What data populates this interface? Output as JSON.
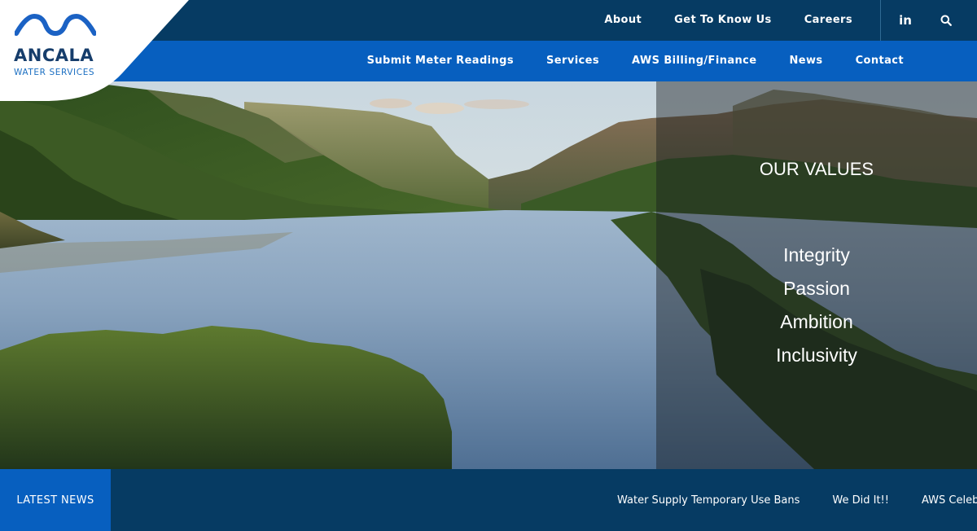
{
  "brand": {
    "name": "ANCALA",
    "tagline": "WATER SERVICES",
    "colors": {
      "navy": "#063b63",
      "blue": "#075fbf",
      "logo_text": "#163d6b"
    }
  },
  "top_nav": {
    "items": [
      {
        "label": "About"
      },
      {
        "label": "Get To Know Us"
      },
      {
        "label": "Careers"
      }
    ],
    "linkedin_text": "in",
    "icons": [
      "linkedin-icon",
      "search-icon"
    ]
  },
  "main_nav": {
    "items": [
      {
        "label": "Submit Meter Readings"
      },
      {
        "label": "Services"
      },
      {
        "label": "AWS Billing/Finance"
      },
      {
        "label": "News"
      },
      {
        "label": "Contact"
      }
    ]
  },
  "hero": {
    "values_title": "OUR VALUES",
    "values": [
      "Integrity",
      "Passion",
      "Ambition",
      "Inclusivity"
    ]
  },
  "news": {
    "label": "LATEST NEWS",
    "items": [
      "Water Supply Temporary Use Bans",
      "We Did It!!",
      "AWS Celebrates"
    ]
  }
}
